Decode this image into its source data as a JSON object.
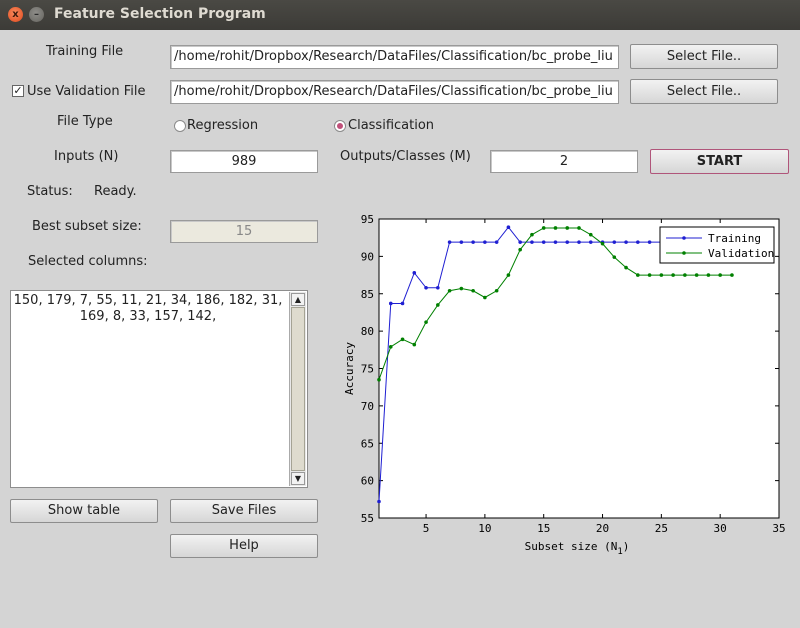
{
  "window": {
    "title": "Feature Selection Program",
    "close_glyph": "x",
    "min_glyph": "–"
  },
  "training": {
    "label": "Training File",
    "path": "/home/rohit/Dropbox/Research/DataFiles/Classification/bc_probe_liu",
    "button": "Select File.."
  },
  "validation": {
    "checked": true,
    "check_glyph": "✓",
    "label": "Use Validation File",
    "path": "/home/rohit/Dropbox/Research/DataFiles/Classification/bc_probe_liu",
    "button": "Select File.."
  },
  "file_type": {
    "label": "File Type",
    "options": [
      {
        "label": "Regression",
        "selected": false
      },
      {
        "label": "Classification",
        "selected": true
      }
    ]
  },
  "inputs": {
    "label": "Inputs (N)",
    "value": "989"
  },
  "outputs": {
    "label": "Outputs/Classes (M)",
    "value": "2"
  },
  "start_button": "START",
  "status": {
    "label": "Status:",
    "value": "Ready."
  },
  "best_subset": {
    "label": "Best subset size:",
    "value": "15"
  },
  "selected": {
    "label": "Selected columns:",
    "line1": "150, 179, 7, 55, 11, 21, 34, 186, 182, 31,",
    "line2": "169, 8, 33, 157, 142,"
  },
  "scroll": {
    "up": "▲",
    "down": "▼"
  },
  "buttons": {
    "show_table": "Show table",
    "save_files": "Save Files",
    "help": "Help"
  },
  "chart_data": {
    "type": "line",
    "xlabel": "Subset size (N",
    "xlabel_sub": "1",
    "xlabel_close": ")",
    "ylabel": "Accuracy",
    "xlim": [
      1,
      35
    ],
    "ylim": [
      55,
      95
    ],
    "xticks": [
      5,
      10,
      15,
      20,
      25,
      30,
      35
    ],
    "yticks": [
      55,
      60,
      65,
      70,
      75,
      80,
      85,
      90,
      95
    ],
    "legend_position": "top-right",
    "grid": false,
    "series": [
      {
        "name": "Training",
        "color": "#1f1fd2",
        "x": [
          1,
          2,
          3,
          4,
          5,
          6,
          7,
          8,
          9,
          10,
          11,
          12,
          13,
          14,
          15,
          16,
          17,
          18,
          19,
          20,
          21,
          22,
          23,
          24,
          25,
          26,
          27,
          28,
          29,
          30,
          31
        ],
        "y": [
          57.2,
          83.7,
          83.7,
          87.8,
          85.8,
          85.8,
          91.9,
          91.9,
          91.9,
          91.9,
          91.9,
          93.9,
          91.9,
          91.9,
          91.9,
          91.9,
          91.9,
          91.9,
          91.9,
          91.9,
          91.9,
          91.9,
          91.9,
          91.9,
          91.9,
          91.9,
          91.9,
          91.9,
          91.9,
          91.9,
          91.9
        ]
      },
      {
        "name": "Validation",
        "color": "#008000",
        "x": [
          1,
          2,
          3,
          4,
          5,
          6,
          7,
          8,
          9,
          10,
          11,
          12,
          13,
          14,
          15,
          16,
          17,
          18,
          19,
          20,
          21,
          22,
          23,
          24,
          25,
          26,
          27,
          28,
          29,
          30,
          31
        ],
        "y": [
          73.5,
          77.9,
          78.9,
          78.2,
          81.2,
          83.5,
          85.4,
          85.7,
          85.4,
          84.5,
          85.4,
          87.5,
          90.9,
          92.9,
          93.8,
          93.8,
          93.8,
          93.8,
          92.9,
          91.7,
          89.9,
          88.5,
          87.5,
          87.5,
          87.5,
          87.5,
          87.5,
          87.5,
          87.5,
          87.5,
          87.5
        ]
      }
    ]
  }
}
